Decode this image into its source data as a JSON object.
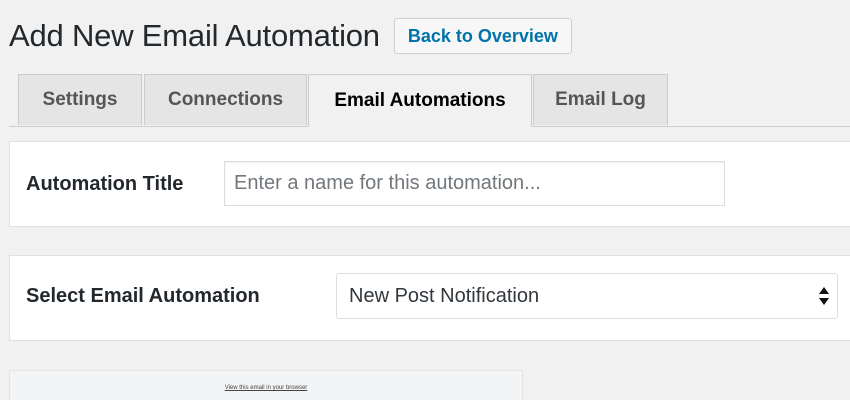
{
  "header": {
    "title": "Add New Email Automation",
    "back_button": "Back to Overview"
  },
  "tabs": [
    {
      "label": "Settings",
      "active": false
    },
    {
      "label": "Connections",
      "active": false
    },
    {
      "label": "Email Automations",
      "active": true
    },
    {
      "label": "Email Log",
      "active": false
    }
  ],
  "automation_title": {
    "label": "Automation Title",
    "value": "",
    "placeholder": "Enter a name for this automation..."
  },
  "select_automation": {
    "label": "Select Email Automation",
    "selected": "New Post Notification"
  },
  "preview": {
    "link_text": "View this email in your browser"
  },
  "colors": {
    "page_background": "#f1f1f1",
    "link_blue": "#0073aa",
    "card_background": "#ffffff",
    "inactive_tab": "#e5e5e5"
  }
}
